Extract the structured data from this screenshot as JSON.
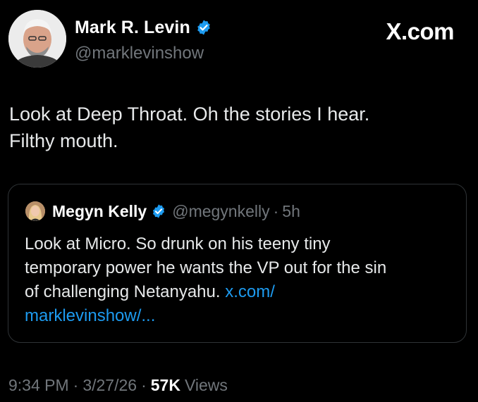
{
  "tweet": {
    "author": {
      "display_name": "Mark R. Levin",
      "handle": "@marklevinshow",
      "verified": true,
      "avatar": "avatar-photo-icon"
    },
    "site_mark": "X.com",
    "text_lines": [
      "Look at Deep Throat. Oh the stories I hear.",
      "Filthy mouth."
    ],
    "quote": {
      "display_name": "Megyn Kelly",
      "handle": "@megynkelly",
      "separator": "·",
      "time": "5h",
      "verified": true,
      "text_lines": [
        "Look at Micro. So drunk on his teeny tiny",
        "temporary power he wants the VP out for the sin",
        "of challenging Netanyahu."
      ],
      "link_part1": "x.com/",
      "link_part2": "marklevinshow/..."
    },
    "meta": {
      "time": "9:34 PM",
      "separator": "·",
      "date": "3/27/26",
      "views_count": "57K",
      "views_label": "Views"
    }
  },
  "colors": {
    "background": "#000000",
    "text_primary": "#e7e9ea",
    "text_secondary": "#71767b",
    "link": "#1d9bf0",
    "verified_badge": "#1d9bf0",
    "card_border": "#2f3336"
  }
}
